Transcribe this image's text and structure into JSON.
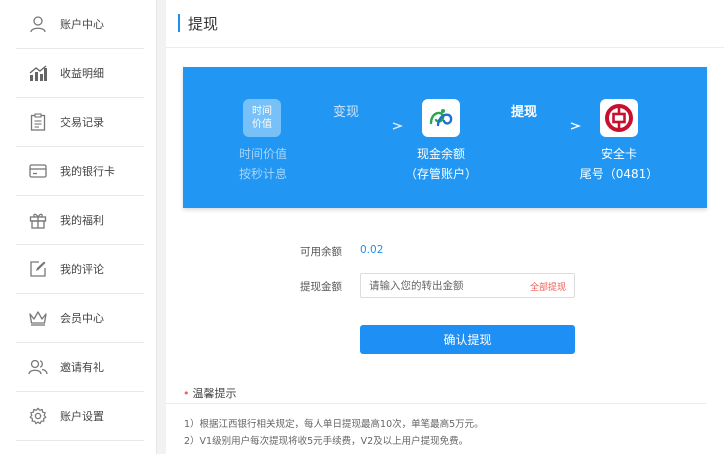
{
  "sidebar": {
    "items": [
      {
        "label": "账户中心",
        "icon": "user-icon"
      },
      {
        "label": "收益明细",
        "icon": "bar-chart-icon"
      },
      {
        "label": "交易记录",
        "icon": "clipboard-icon"
      },
      {
        "label": "我的银行卡",
        "icon": "card-icon"
      },
      {
        "label": "我的福利",
        "icon": "gift-icon"
      },
      {
        "label": "我的评论",
        "icon": "edit-icon"
      },
      {
        "label": "会员中心",
        "icon": "crown-icon"
      },
      {
        "label": "邀请有礼",
        "icon": "users-icon"
      },
      {
        "label": "账户设置",
        "icon": "gear-icon"
      }
    ]
  },
  "page": {
    "title": "提现"
  },
  "banner": {
    "time_icon_text": "时间\n价值",
    "time_line1": "时间价值",
    "time_line2": "按秒计息",
    "arrow1_label": "变现",
    "cash_title": "现金余额",
    "cash_sub": "（存管账户）",
    "arrow2_label": "提现",
    "card_title": "安全卡",
    "card_sub": "尾号（0481）"
  },
  "form": {
    "balance_label": "可用余额",
    "balance_value": "0.02",
    "amount_label": "提现金额",
    "amount_placeholder": "请输入您的转出金额",
    "all_label": "全部提现",
    "confirm_label": "确认提现"
  },
  "tips": {
    "title": "温馨提示",
    "items": [
      "1）根据江西银行相关规定，每人单日提现最高10次，单笔最高5万元。",
      "2）V1级别用户每次提现将收5元手续费，V2及以上用户提现免费。"
    ]
  },
  "colors": {
    "accent": "#1e8ff5",
    "banner": "#2196f3",
    "bank_red": "#c8102e",
    "warn": "#f25c54"
  }
}
